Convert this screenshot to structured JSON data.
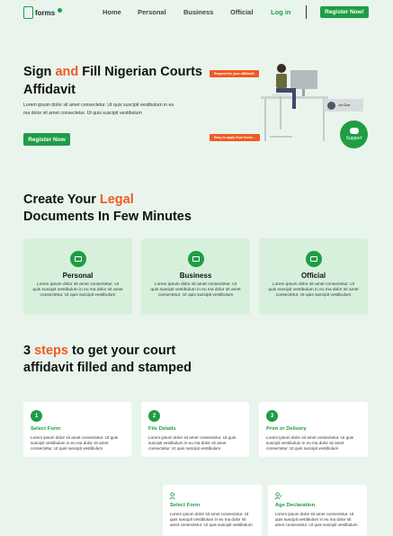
{
  "nav": {
    "logo": "forms",
    "links": [
      "Home",
      "Personal",
      "Business",
      "Official"
    ],
    "login": "Log in",
    "cta": "Register Now!"
  },
  "hero": {
    "title_pre": "Sign ",
    "title_accent": "and",
    "title_post": " Fill Nigerian Courts Affidavit",
    "subtitle": "Lorem ipsum dolor sit amet consectetur. Ut quis suscipit vestibulum in eu ma dolor sit amet consectetur. Ut quis suscipit vestibulum",
    "cta": "Register Now",
    "tag_top": "Request for your affidavit!",
    "tag_bottom": "Easy to apply from home...",
    "user_tag": "Jon Doe",
    "support": "Support"
  },
  "docs": {
    "heading_pre": "Create Your ",
    "heading_accent": "Legal",
    "heading_post": "Documents In Few Minutes",
    "cards": [
      {
        "title": "Personal",
        "desc": "Lorem ipsum dolor sit amet consectetur. Ut quis suscipit vestibulum in eu ma dolor sit amet consectetur. Ut quis suscipit vestibulum"
      },
      {
        "title": "Business",
        "desc": "Lorem ipsum dolor sit amet consectetur. Ut quis suscipit vestibulum in eu ma dolor sit amet consectetur. Ut quis suscipit vestibulum"
      },
      {
        "title": "Official",
        "desc": "Lorem ipsum dolor sit amet consectetur. Ut quis suscipit vestibulum in eu ma dolor sit amet consectetur. Ut quis suscipit vestibulum"
      }
    ]
  },
  "steps": {
    "heading_num": "3 ",
    "heading_accent": "steps",
    "heading_post": " to get your court affidavit filled and stamped",
    "items": [
      {
        "num": "1",
        "title": "Select Form",
        "desc": "Lorem ipsum dolor sit amet consectetur. Ut quis suscipit vestibulum in eu ma dolor sit amet consectetur. Ut quis suscipit vestibulum"
      },
      {
        "num": "2",
        "title": "File Details",
        "desc": "Lorem ipsum dolor sit amet consectetur. Ut quis suscipit vestibulum in eu ma dolor sit amet consectetur. Ut quis suscipit vestibulum"
      },
      {
        "num": "3",
        "title": "Print or Delivery",
        "desc": "Lorem ipsum dolor sit amet consectetur. Ut quis suscipit vestibulum in eu ma dolor sit amet consectetur. Ut quis suscipit vestibulum"
      }
    ],
    "extra": [
      {
        "title": "Select Form",
        "desc": "Lorem ipsum dolor sit amet consectetur. Ut quis suscipit vestibulum in eu ma dolor sit amet consectetur. Ut quis suscipit vestibulum"
      },
      {
        "title": "Age Declaration",
        "desc": "Lorem ipsum dolor sit amet consectetur. Ut quis suscipit vestibulum in eu ma dolor sit amet consectetur. Ut quis suscipit vestibulum"
      }
    ]
  },
  "colors": {
    "brand": "#1f9d45",
    "accent": "#f05a22",
    "background": "#e9f5ec"
  }
}
